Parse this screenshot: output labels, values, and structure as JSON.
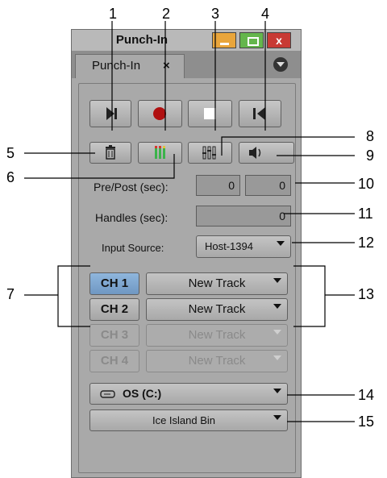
{
  "callouts": [
    "1",
    "2",
    "3",
    "4",
    "5",
    "6",
    "7",
    "8",
    "9",
    "10",
    "11",
    "12",
    "13",
    "14",
    "15"
  ],
  "window": {
    "title": "Punch-In",
    "close_glyph": "x",
    "tab_label": "Punch-In",
    "tab_close_glyph": "×"
  },
  "transport": {
    "play_icon": "play-to-mark-icon",
    "record_icon": "record-icon",
    "stop_icon": "stop-icon",
    "goto_icon": "go-to-in-icon"
  },
  "tools": {
    "trash_icon": "trash-icon",
    "meters_icon": "audio-meters-icon",
    "mixer_icon": "mixer-icon",
    "speaker_icon": "speaker-icon"
  },
  "settings": {
    "prepost_label": "Pre/Post (sec):",
    "pre_value": "0",
    "post_value": "0",
    "handles_label": "Handles (sec):",
    "handles_value": "0",
    "input_source_label": "Input Source:",
    "input_source_value": "Host-1394"
  },
  "channels": [
    {
      "label": "CH 1",
      "track": "New Track"
    },
    {
      "label": "CH 2",
      "track": "New Track"
    },
    {
      "label": "CH 3",
      "track": "New Track"
    },
    {
      "label": "CH 4",
      "track": "New Track"
    }
  ],
  "drive": {
    "label": "OS (C:)",
    "icon": "drive-icon"
  },
  "bin": {
    "label": "Ice Island Bin"
  },
  "colors": {
    "panel": "#a9a9a9",
    "active_channel": "#7fa7d0",
    "record": "#b01010",
    "meter_green": "#3bb34a",
    "meter_red": "#d8352a",
    "min_button": "#e9a53b",
    "max_button": "#64b64c",
    "close_button": "#c83a34"
  }
}
